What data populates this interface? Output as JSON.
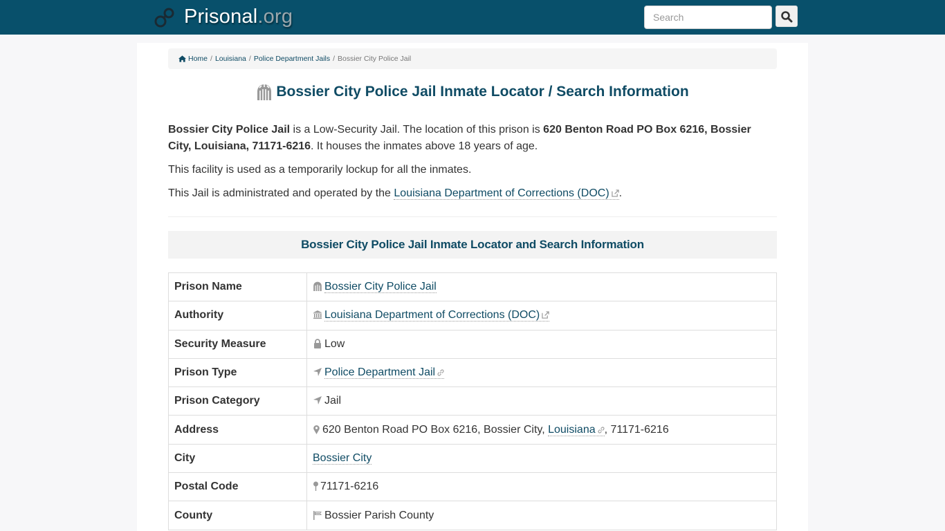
{
  "header": {
    "brand_main": "Prisonal",
    "brand_tld": ".org",
    "search_placeholder": "Search",
    "search_icon": "search-icon",
    "logo_icon": "handcuffs-icon"
  },
  "breadcrumb": {
    "items": [
      "Home",
      "Louisiana",
      "Police Department Jails"
    ],
    "current": "Bossier City Police Jail",
    "separator": "/"
  },
  "page": {
    "title": "Bossier City Police Jail Inmate Locator / Search Information",
    "intro": {
      "p1_name": "Bossier City Police Jail",
      "p1_text1": " is a Low-Security Jail. The location of this prison is ",
      "p1_address": "620 Benton Road PO Box 6216, Bossier City, Louisiana, 71171-6216",
      "p1_text2": ". It houses the inmates above 18 years of age.",
      "p2": "This facility is used as a temporarily lockup for all the inmates.",
      "p3_text": "This Jail is administrated and operated by the ",
      "p3_link": "Louisiana Department of Corrections (DOC)",
      "p3_end": "."
    },
    "section_title": "Bossier City Police Jail Inmate Locator and Search Information"
  },
  "table": {
    "rows": [
      {
        "label": "Prison Name",
        "value": "Bossier City Police Jail"
      },
      {
        "label": "Authority",
        "value": "Louisiana Department of Corrections (DOC)"
      },
      {
        "label": "Security Measure",
        "value": "Low"
      },
      {
        "label": "Prison Type",
        "value": "Police Department Jail"
      },
      {
        "label": "Prison Category",
        "value": "Jail"
      },
      {
        "label": "Address",
        "value_pre": "620 Benton Road PO Box 6216, Bossier City, ",
        "value_link": "Louisiana",
        "value_post": ", 71171-6216"
      },
      {
        "label": "City",
        "value": "Bossier City"
      },
      {
        "label": "Postal Code",
        "value": "71171-6216"
      },
      {
        "label": "County",
        "value": "Bossier Parish County"
      }
    ]
  },
  "colors": {
    "navbar": "#08506b",
    "accent": "#0f4b64"
  }
}
